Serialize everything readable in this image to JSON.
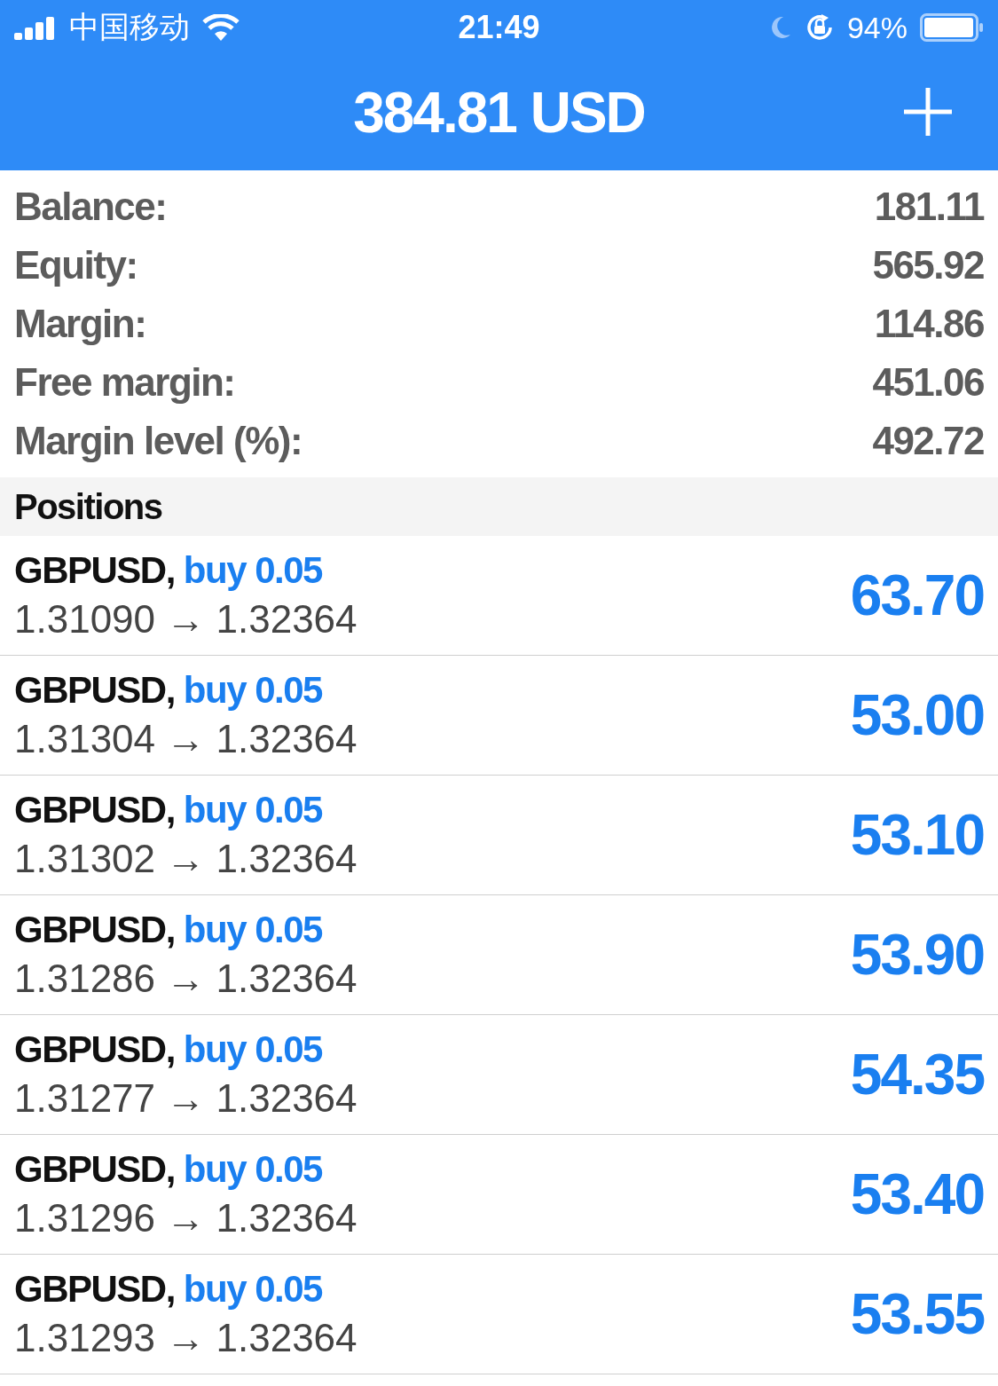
{
  "status_bar": {
    "carrier": "中国移动",
    "time": "21:49",
    "battery": "94%"
  },
  "header": {
    "title": "384.81 USD"
  },
  "account": [
    {
      "label": "Balance:",
      "value": "181.11"
    },
    {
      "label": "Equity:",
      "value": "565.92"
    },
    {
      "label": "Margin:",
      "value": "114.86"
    },
    {
      "label": "Free margin:",
      "value": "451.06"
    },
    {
      "label": "Margin level (%):",
      "value": "492.72"
    }
  ],
  "positions_title": "Positions",
  "positions": [
    {
      "symbol": "GBPUSD,",
      "order": "buy 0.05",
      "prices": "1.31090 → 1.32364",
      "profit": "63.70"
    },
    {
      "symbol": "GBPUSD,",
      "order": "buy 0.05",
      "prices": "1.31304 → 1.32364",
      "profit": "53.00"
    },
    {
      "symbol": "GBPUSD,",
      "order": "buy 0.05",
      "prices": "1.31302 → 1.32364",
      "profit": "53.10"
    },
    {
      "symbol": "GBPUSD,",
      "order": "buy 0.05",
      "prices": "1.31286 → 1.32364",
      "profit": "53.90"
    },
    {
      "symbol": "GBPUSD,",
      "order": "buy 0.05",
      "prices": "1.31277 → 1.32364",
      "profit": "54.35"
    },
    {
      "symbol": "GBPUSD,",
      "order": "buy 0.05",
      "prices": "1.31296 → 1.32364",
      "profit": "53.40"
    },
    {
      "symbol": "GBPUSD,",
      "order": "buy 0.05",
      "prices": "1.31293 → 1.32364",
      "profit": "53.55"
    }
  ]
}
